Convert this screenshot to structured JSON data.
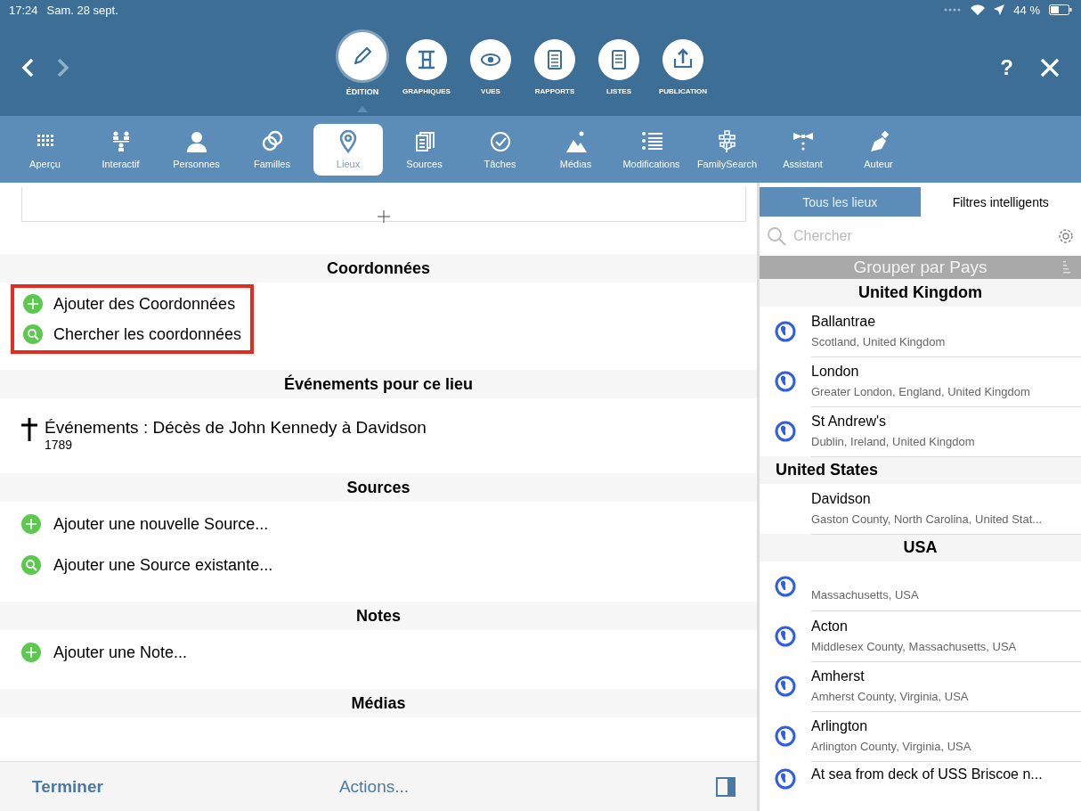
{
  "status_bar": {
    "time": "17:24",
    "date": "Sam. 28 sept.",
    "battery": "44 %"
  },
  "toolbar": {
    "modes": [
      {
        "label": "ÉDITION",
        "selected": true
      },
      {
        "label": "GRAPHIQUES",
        "selected": false
      },
      {
        "label": "VUES",
        "selected": false
      },
      {
        "label": "RAPPORTS",
        "selected": false
      },
      {
        "label": "LISTES",
        "selected": false
      },
      {
        "label": "PUBLICATION",
        "selected": false
      }
    ],
    "help": "?"
  },
  "tabs": [
    {
      "label": "Aperçu",
      "selected": false
    },
    {
      "label": "Interactif",
      "selected": false
    },
    {
      "label": "Personnes",
      "selected": false
    },
    {
      "label": "Familles",
      "selected": false
    },
    {
      "label": "Lieux",
      "selected": true
    },
    {
      "label": "Sources",
      "selected": false
    },
    {
      "label": "Tâches",
      "selected": false
    },
    {
      "label": "Médias",
      "selected": false
    },
    {
      "label": "Modifications",
      "selected": false
    },
    {
      "label": "FamilySearch",
      "selected": false
    },
    {
      "label": "Assistant",
      "selected": false
    },
    {
      "label": "Auteur",
      "selected": false
    }
  ],
  "detail": {
    "sections": [
      {
        "title": "Coordonnées",
        "highlighted": true,
        "rows": [
          {
            "kind": "add",
            "label": "Ajouter des Coordonnées"
          },
          {
            "kind": "search",
            "label": "Chercher les coordonnées"
          }
        ]
      },
      {
        "title": "Événements pour ce lieu",
        "highlighted": false,
        "rows": [
          {
            "kind": "death",
            "label": "Événements : Décès de John Kennedy à Davidson",
            "sub": "1789"
          }
        ]
      },
      {
        "title": "Sources",
        "highlighted": false,
        "rows": [
          {
            "kind": "add",
            "label": "Ajouter une nouvelle Source..."
          },
          {
            "kind": "search",
            "label": "Ajouter une Source existante..."
          }
        ]
      },
      {
        "title": "Notes",
        "highlighted": false,
        "rows": [
          {
            "kind": "add",
            "label": "Ajouter une Note..."
          }
        ]
      },
      {
        "title": "Médias",
        "highlighted": false
      }
    ]
  },
  "bottom_bar": {
    "done": "Terminer",
    "actions": "Actions..."
  },
  "places": {
    "tabs": [
      {
        "label": "Tous les lieux",
        "selected": true
      },
      {
        "label": "Filtres intelligents",
        "selected": false
      }
    ],
    "search": {
      "placeholder": "Chercher"
    },
    "group_by": "Grouper par Pays",
    "groups": [
      {
        "name": "United Kingdom",
        "centered": true,
        "items": [
          {
            "name": "Ballantrae",
            "detail": "Scotland, United Kingdom",
            "globe": true
          },
          {
            "name": "London",
            "detail": "Greater London, England, United Kingdom",
            "globe": true
          },
          {
            "name": "St Andrew's",
            "detail": "Dublin, Ireland, United Kingdom",
            "globe": true
          }
        ]
      },
      {
        "name": "United States",
        "centered": false,
        "items": [
          {
            "name": "Davidson",
            "detail": "Gaston County, North Carolina, United Stat...",
            "globe": false
          }
        ]
      },
      {
        "name": "USA",
        "centered": true,
        "items": [
          {
            "detail": "Massachusetts, USA",
            "globe": true
          },
          {
            "name": "Acton",
            "detail": "Middlesex County, Massachusetts, USA",
            "globe": true
          },
          {
            "name": "Amherst",
            "detail": "Amherst County, Virginia, USA",
            "globe": true
          },
          {
            "name": "Arlington",
            "detail": "Arlington County, Virginia, USA",
            "globe": true
          },
          {
            "name": "At sea from deck of USS Briscoe n...",
            "globe": true
          }
        ]
      }
    ]
  }
}
